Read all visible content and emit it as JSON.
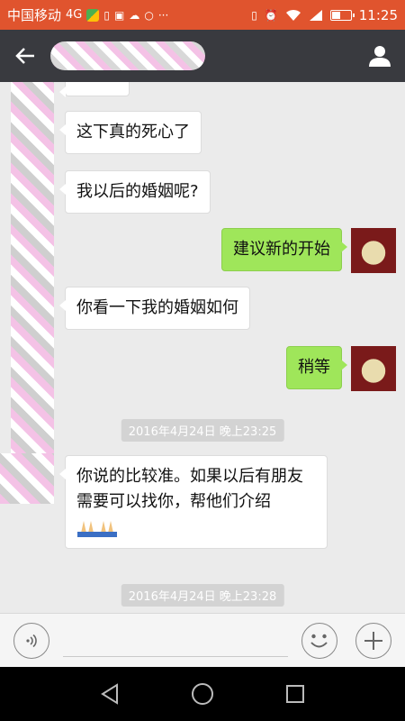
{
  "status_bar": {
    "carrier": "中国移动",
    "network": "4G",
    "time": "11:25",
    "background_color": "#e0542e",
    "icons": [
      "app-icon",
      "sim-icon",
      "image-icon",
      "cloud-icon",
      "circle-icon",
      "more-icon",
      "vibrate-icon",
      "alarm-icon",
      "wifi-icon",
      "signal-icon",
      "battery-icon"
    ]
  },
  "title_bar": {
    "background_color": "#393a3f",
    "back_icon": "back-arrow-icon",
    "profile_icon": "person-icon"
  },
  "chat": {
    "messages": [
      {
        "direction": "in",
        "text": "这下真的死心了"
      },
      {
        "direction": "in",
        "text": "我以后的婚姻呢?"
      },
      {
        "direction": "out",
        "text": "建议新的开始"
      },
      {
        "direction": "in",
        "text": "你看一下我的婚姻如何"
      },
      {
        "direction": "out",
        "text": "稍等"
      },
      {
        "type": "timestamp",
        "text": "2016年4月24日 晚上23:25"
      },
      {
        "direction": "in",
        "text": "你说的比较准。如果以后有朋友需要可以找你，帮他们介绍",
        "emoji": "folded-hands-emoji"
      },
      {
        "type": "timestamp",
        "text": "2016年4月24日 晚上23:28"
      }
    ],
    "incoming_bubble_color": "#ffffff",
    "outgoing_bubble_color": "#9fe65a"
  },
  "input_bar": {
    "voice_icon": "voice-icon",
    "emoji_icon": "emoji-icon",
    "plus_icon": "plus-icon"
  },
  "nav_bar": {
    "icons": [
      "back-triangle-icon",
      "home-circle-icon",
      "recents-square-icon"
    ]
  }
}
